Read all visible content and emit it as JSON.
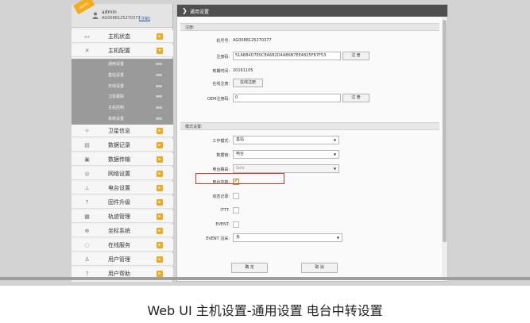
{
  "user": {
    "ribbon": "admin",
    "name": "admin",
    "id": "AG0088125270377",
    "logout": "[注销]"
  },
  "sidebar": {
    "items": [
      {
        "label": "主机状态",
        "icon": "monitor-icon"
      },
      {
        "label": "主机配置",
        "icon": "tools-icon"
      },
      {
        "label": "卫星信息",
        "icon": "satellite-icon"
      },
      {
        "label": "数据记录",
        "icon": "record-icon"
      },
      {
        "label": "数据传输",
        "icon": "transfer-icon"
      },
      {
        "label": "网络设置",
        "icon": "network-icon"
      },
      {
        "label": "电台设置",
        "icon": "radio-icon"
      },
      {
        "label": "固件升级",
        "icon": "upgrade-icon"
      },
      {
        "label": "轨迹管理",
        "icon": "track-icon"
      },
      {
        "label": "坐标系统",
        "icon": "coordinate-icon"
      },
      {
        "label": "在线服务",
        "icon": "online-icon"
      },
      {
        "label": "用户管理",
        "icon": "user-manage-icon"
      },
      {
        "label": "用户帮助",
        "icon": "help-icon"
      }
    ],
    "submenu": [
      {
        "label": "通用设置"
      },
      {
        "label": "基站设置"
      },
      {
        "label": "天线设置"
      },
      {
        "label": "卫星跟踪"
      },
      {
        "label": "主机控制"
      },
      {
        "label": "系统设置"
      }
    ]
  },
  "main": {
    "title": "通用设置",
    "register": {
      "section": "注册:",
      "machine_no_label": "机号号:",
      "machine_no": "AG0088125270377",
      "reg_code_label": "注册码:",
      "reg_code": "51AB84D7E0CEA6B2D4AB6B7EE4825FB7F53",
      "reg_button": "注 册",
      "expire_label": "到期时间:",
      "expire": "20161105",
      "online_label": "在线注册:",
      "online_button": "在线注册",
      "oem_label": "OEM注册码:",
      "oem_value": "0",
      "oem_button": "注 册"
    },
    "mode": {
      "section": "模式设置:",
      "work_mode_label": "工作模式:",
      "work_mode": "基站",
      "data_link_label": "数据链:",
      "data_link": "电台",
      "radio_route_label": "电台路由:",
      "radio_route": "Sole",
      "relay_label": "电台中转:",
      "relay_checked": true,
      "dynamic_label": "动态记录:",
      "ittt_label": "ITTT:",
      "event_label": "EVENT:",
      "event_edge_label": "EVENT 沿采:",
      "event_edge": "负"
    },
    "confirm_button": "确 定",
    "cancel_button": "取 消"
  },
  "caption": "Web UI  主机设置-通用设置  电台中转设置",
  "colors": {
    "badge": "#f0a81c",
    "title_bar": "#4f4f4f",
    "submenu_bg": "#9a9a9a",
    "highlight": "#d6322c"
  }
}
